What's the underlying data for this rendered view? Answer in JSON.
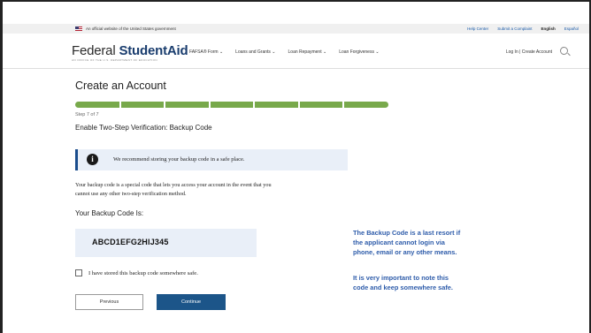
{
  "gov_banner": {
    "text": "An official website of the United States government",
    "links": [
      "Help Center",
      "Submit a Complaint",
      "English",
      "Español"
    ]
  },
  "header": {
    "logo_part1": "Federal ",
    "logo_part2": "StudentAid",
    "logo_sub": "AN OFFICE OF THE U.S. DEPARTMENT OF EDUCATION",
    "nav": [
      "FAFSA® Form",
      "Loans and Grants",
      "Loan Repayment",
      "Loan Forgiveness"
    ],
    "account_links": "Log In  |  Create Account"
  },
  "main": {
    "page_title": "Create an Account",
    "step_label": "Step 7 of 7",
    "step_title": "Enable Two-Step Verification: Backup Code",
    "progress_fraction": 1.0,
    "progress_steps": 7,
    "alert_text": "We recommend storing your backup code in a safe place.",
    "description_line1": "Your backup code is a special code that lets you access your account in the event that you",
    "description_line2": "cannot use any other two-step verification method.",
    "code_label": "Your Backup Code Is:",
    "code_value": "ABCD1EFG2HIJ345",
    "stored_checkbox_label": "I have stored this backup code somewhere safe.",
    "stored_checked": false,
    "previous_label": "Previous",
    "continue_label": "Continue"
  },
  "annotation": {
    "note1": [
      "The Backup Code is a last resort if",
      "the applicant cannot login via",
      "phone, email or any other means."
    ],
    "note2": [
      "It is very important to note this",
      "code and keep somewhere safe."
    ]
  },
  "colors": {
    "progress": "#78a94b",
    "primary_button": "#1c5589",
    "note_text": "#2e5caa",
    "alert_bg": "#e9eff8"
  }
}
